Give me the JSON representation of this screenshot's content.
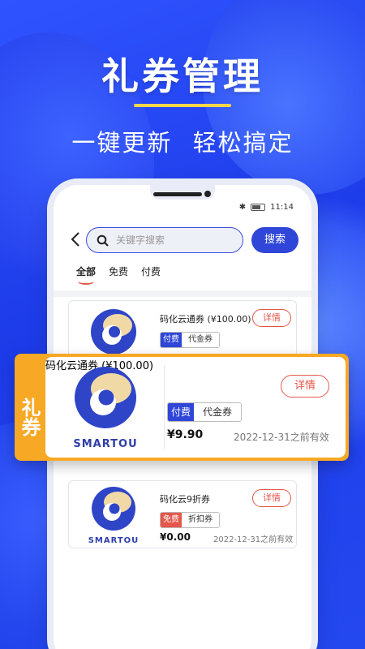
{
  "hero": {
    "title": "礼券管理",
    "subtitle": "一键更新  轻松搞定",
    "accent_color": "#f6d64a"
  },
  "status_bar": {
    "time": "11:14",
    "icons": [
      "bluetooth-icon",
      "battery-icon"
    ]
  },
  "search": {
    "placeholder": "关键字搜索",
    "button_label": "搜索"
  },
  "tabs": [
    {
      "label": "全部",
      "active": true
    },
    {
      "label": "免费",
      "active": false
    },
    {
      "label": "付费",
      "active": false
    }
  ],
  "logo_text": "SMARTOU",
  "coupons": [
    {
      "title": "码化云通券 (¥100.00)",
      "kind": "付费",
      "kind_color": "#2f46d8",
      "type": "代金券",
      "price": "",
      "expiry": "",
      "detail_label": "详情"
    },
    {
      "title": "码化云9折券",
      "kind": "免费",
      "kind_color": "#e4574a",
      "type": "折扣券",
      "price": "¥0.00",
      "expiry": "2022-12-31之前有效",
      "detail_label": "详情"
    }
  ],
  "highlight": {
    "side_label": "礼券",
    "title": "码化云通券 (¥100.00)",
    "kind": "付费",
    "kind_color": "#2f46d8",
    "type": "代金券",
    "price": "¥9.90",
    "expiry": "2022-12-31之前有效",
    "detail_label": "详情",
    "frame_color": "#f7a824"
  }
}
